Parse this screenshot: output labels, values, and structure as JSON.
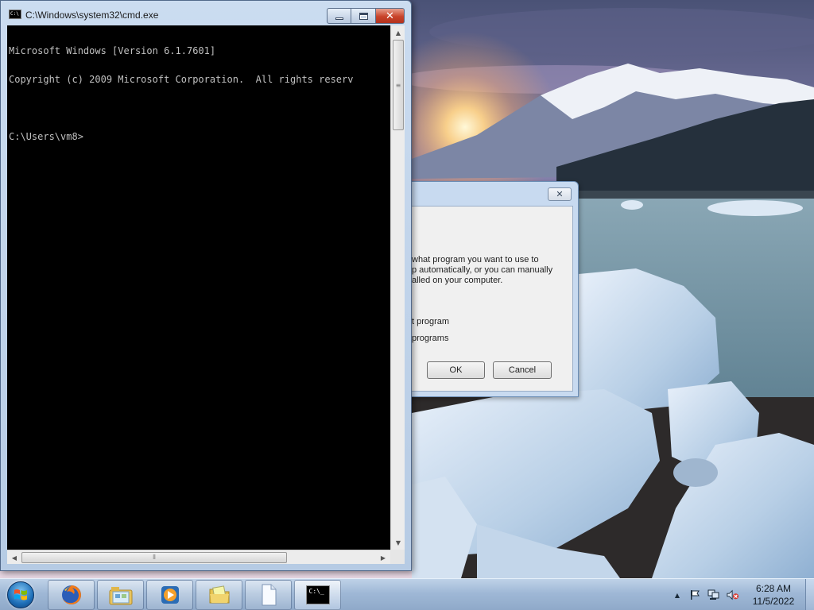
{
  "cmd_window": {
    "title": "C:\\Windows\\system32\\cmd.exe",
    "icon": "cmd-icon",
    "icon_text": "C:\\",
    "console_lines": [
      "Microsoft Windows [Version 6.1.7601]",
      "Copyright (c) 2009 Microsoft Corporation.  All rights reserv",
      "",
      "C:\\Users\\vm8>"
    ],
    "buttons": {
      "minimize": "minimize-icon",
      "maximize": "maximize-icon",
      "close": "close-icon",
      "close_glyph": "✕"
    }
  },
  "dialog": {
    "close_glyph": "✕",
    "text_line_1": " what program you want to use to",
    "text_line_2": "p automatically, or you can manually",
    "text_line_3": "alled on your computer.",
    "option_1": "t program",
    "option_2": " programs",
    "ok_label": "OK",
    "cancel_label": "Cancel"
  },
  "taskbar": {
    "start_icon": "windows-start-orb",
    "pinned": [
      {
        "name": "firefox-icon"
      },
      {
        "name": "windows-explorer-icon"
      },
      {
        "name": "media-player-icon"
      },
      {
        "name": "folder-icon"
      },
      {
        "name": "document-icon"
      },
      {
        "name": "cmd-icon"
      }
    ],
    "cmd_task_text": "C:\\_",
    "tray": {
      "show_hidden": "▲",
      "action_center": "flag-icon",
      "network": "network-icon",
      "volume": "volume-muted-icon"
    },
    "clock_time": "6:28 AM",
    "clock_date": "11/5/2022"
  }
}
